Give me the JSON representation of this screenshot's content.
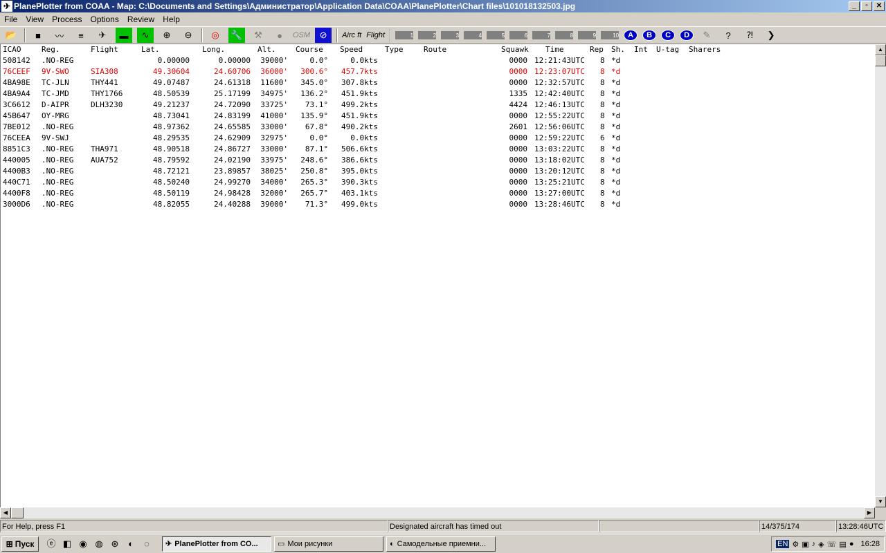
{
  "window": {
    "title": "PlanePlotter from COAA - Map: C:\\Documents and Settings\\Администратор\\Application Data\\COAA\\PlanePlotter\\Chart files\\101018132503.jpg",
    "minimize": "_",
    "maximize": "▫",
    "close": "✕"
  },
  "menu": [
    "File",
    "View",
    "Process",
    "Options",
    "Review",
    "Help"
  ],
  "toolbar": {
    "aircraft_label": "Airc ft",
    "flight_label": "Flight",
    "osm_label": "OSM",
    "nums": [
      "1",
      "2",
      "3",
      "4",
      "5",
      "6",
      "7",
      "8",
      "9",
      "10"
    ],
    "circles": [
      "A",
      "B",
      "C",
      "D"
    ]
  },
  "table": {
    "headers": [
      "ICAO",
      "Reg.",
      "Flight",
      "Lat.",
      "Long.",
      "Alt.",
      "Course",
      "Speed",
      "Type",
      "Route",
      "Squawk",
      "Time",
      "Rep",
      "Sh.",
      "Int",
      "U-tag",
      "Sharers"
    ],
    "rows": [
      {
        "icao": "508142",
        "reg": ".NO-REG",
        "flight": "",
        "lat": "0.00000",
        "long": "0.00000",
        "alt": "39000'",
        "course": "0.0°",
        "speed": "0.0kts",
        "squawk": "0000",
        "time": "12:21:43UTC",
        "rep": "8",
        "sh": "*d",
        "highlight": false
      },
      {
        "icao": "76CEEF",
        "reg": "9V-SWO",
        "flight": "SIA308",
        "lat": "49.30604",
        "long": "24.60706",
        "alt": "36000'",
        "course": "300.6°",
        "speed": "457.7kts",
        "squawk": "0000",
        "time": "12:23:07UTC",
        "rep": "8",
        "sh": "*d",
        "highlight": true
      },
      {
        "icao": "4BA98E",
        "reg": "TC-JLN",
        "flight": "THY441",
        "lat": "49.07487",
        "long": "24.61318",
        "alt": "11600'",
        "course": "345.0°",
        "speed": "307.8kts",
        "squawk": "0000",
        "time": "12:32:57UTC",
        "rep": "8",
        "sh": "*d",
        "highlight": false
      },
      {
        "icao": "4BA9A4",
        "reg": "TC-JMD",
        "flight": "THY1766",
        "lat": "48.50539",
        "long": "25.17199",
        "alt": "34975'",
        "course": "136.2°",
        "speed": "451.9kts",
        "squawk": "1335",
        "time": "12:42:40UTC",
        "rep": "8",
        "sh": "*d",
        "highlight": false
      },
      {
        "icao": "3C6612",
        "reg": "D-AIPR",
        "flight": "DLH3230",
        "lat": "49.21237",
        "long": "24.72090",
        "alt": "33725'",
        "course": "73.1°",
        "speed": "499.2kts",
        "squawk": "4424",
        "time": "12:46:13UTC",
        "rep": "8",
        "sh": "*d",
        "highlight": false
      },
      {
        "icao": "45B647",
        "reg": "OY-MRG",
        "flight": "",
        "lat": "48.73041",
        "long": "24.83199",
        "alt": "41000'",
        "course": "135.9°",
        "speed": "451.9kts",
        "squawk": "0000",
        "time": "12:55:22UTC",
        "rep": "8",
        "sh": "*d",
        "highlight": false
      },
      {
        "icao": "7BE012",
        "reg": ".NO-REG",
        "flight": "",
        "lat": "48.97362",
        "long": "24.65585",
        "alt": "33000'",
        "course": "67.8°",
        "speed": "490.2kts",
        "squawk": "2601",
        "time": "12:56:06UTC",
        "rep": "8",
        "sh": "*d",
        "highlight": false
      },
      {
        "icao": "76CEEA",
        "reg": "9V-SWJ",
        "flight": "",
        "lat": "48.29535",
        "long": "24.62909",
        "alt": "32975'",
        "course": "0.0°",
        "speed": "0.0kts",
        "squawk": "0000",
        "time": "12:59:22UTC",
        "rep": "6",
        "sh": "*d",
        "highlight": false
      },
      {
        "icao": "8851C3",
        "reg": ".NO-REG",
        "flight": "THA971",
        "lat": "48.90518",
        "long": "24.86727",
        "alt": "33000'",
        "course": "87.1°",
        "speed": "506.6kts",
        "squawk": "0000",
        "time": "13:03:22UTC",
        "rep": "8",
        "sh": "*d",
        "highlight": false
      },
      {
        "icao": "440005",
        "reg": ".NO-REG",
        "flight": "AUA752",
        "lat": "48.79592",
        "long": "24.02190",
        "alt": "33975'",
        "course": "248.6°",
        "speed": "386.6kts",
        "squawk": "0000",
        "time": "13:18:02UTC",
        "rep": "8",
        "sh": "*d",
        "highlight": false
      },
      {
        "icao": "4400B3",
        "reg": ".NO-REG",
        "flight": "",
        "lat": "48.72121",
        "long": "23.89857",
        "alt": "38025'",
        "course": "250.8°",
        "speed": "395.0kts",
        "squawk": "0000",
        "time": "13:20:12UTC",
        "rep": "8",
        "sh": "*d",
        "highlight": false
      },
      {
        "icao": "440C71",
        "reg": ".NO-REG",
        "flight": "",
        "lat": "48.50240",
        "long": "24.99270",
        "alt": "34000'",
        "course": "265.3°",
        "speed": "390.3kts",
        "squawk": "0000",
        "time": "13:25:21UTC",
        "rep": "8",
        "sh": "*d",
        "highlight": false
      },
      {
        "icao": "4400F8",
        "reg": ".NO-REG",
        "flight": "",
        "lat": "48.50119",
        "long": "24.98428",
        "alt": "32000'",
        "course": "265.7°",
        "speed": "403.1kts",
        "squawk": "0000",
        "time": "13:27:00UTC",
        "rep": "8",
        "sh": "*d",
        "highlight": false
      },
      {
        "icao": "3000D6",
        "reg": ".NO-REG",
        "flight": "",
        "lat": "48.82055",
        "long": "24.40288",
        "alt": "39000'",
        "course": "71.3°",
        "speed": "499.0kts",
        "squawk": "0000",
        "time": "13:28:46UTC",
        "rep": "8",
        "sh": "*d",
        "highlight": false
      }
    ]
  },
  "status": {
    "help": "For Help, press F1",
    "message": "Designated aircraft has timed out",
    "blank": "",
    "counts": "14/375/174",
    "utc": "13:28:46UTC"
  },
  "taskbar": {
    "start": "Пуск",
    "tasks": [
      "PlanePlotter from CO...",
      "Мои рисунки",
      "Самодельные приемни..."
    ],
    "lang": "EN",
    "clock": "16:28"
  }
}
